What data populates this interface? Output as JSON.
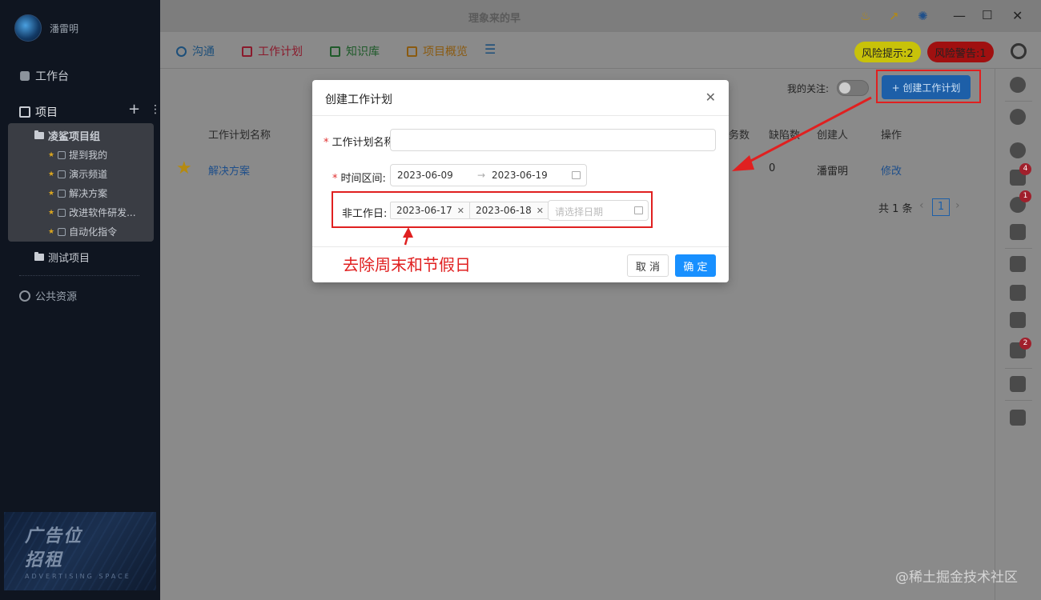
{
  "sidebar": {
    "user_name": "潘雷明",
    "workbench": "工作台",
    "projects": "项目",
    "add": "+",
    "more": "⋮",
    "group": {
      "name": "凌鲨项目组",
      "items": [
        "提到我的",
        "演示频道",
        "解决方案",
        "改进软件研发...",
        "自动化指令"
      ]
    },
    "test_project": "测试项目",
    "public_resources": "公共资源",
    "ad": {
      "line1": "广告位",
      "line2": "招租",
      "sub": "ADVERTISING SPACE"
    }
  },
  "topbar": {
    "title": "理象来的早"
  },
  "tabs": [
    {
      "label": "沟通",
      "color": "#1d4f7a"
    },
    {
      "label": "工作计划",
      "color": "#8a1a2c"
    },
    {
      "label": "知识库",
      "color": "#1f5a2a"
    },
    {
      "label": "项目概览",
      "color": "#8a5a10"
    }
  ],
  "risk_tip": "风险提示:2",
  "risk_warn": "风险警告:1",
  "follow_label": "我的关注:",
  "create_button": "+ 创建工作计划",
  "table": {
    "headers": [
      "工作计划名称",
      "务数",
      "缺陷数",
      "创建人",
      "操作"
    ],
    "row": {
      "name": "解决方案",
      "defects": "0",
      "creator": "潘雷明",
      "action": "修改"
    },
    "total": "共 1 条",
    "page": "1"
  },
  "right_badges": [
    "4",
    "1",
    "2"
  ],
  "modal": {
    "title": "创建工作计划",
    "name_label": "工作计划名称",
    "range_label": "时间区间:",
    "start_date": "2023-06-09",
    "end_date": "2023-06-19",
    "nonwork_label": "非工作日:",
    "tags": [
      "2023-06-17",
      "2023-06-18"
    ],
    "date_placeholder": "请选择日期",
    "cancel": "取 消",
    "ok": "确 定"
  },
  "annotation": "去除周末和节假日",
  "watermark": "@稀土掘金技术社区",
  "colors": {
    "accent": "#1890ff",
    "annotation": "#e02020",
    "risk_tip_bg": "#c8c20a",
    "risk_warn_bg": "#a01010"
  }
}
